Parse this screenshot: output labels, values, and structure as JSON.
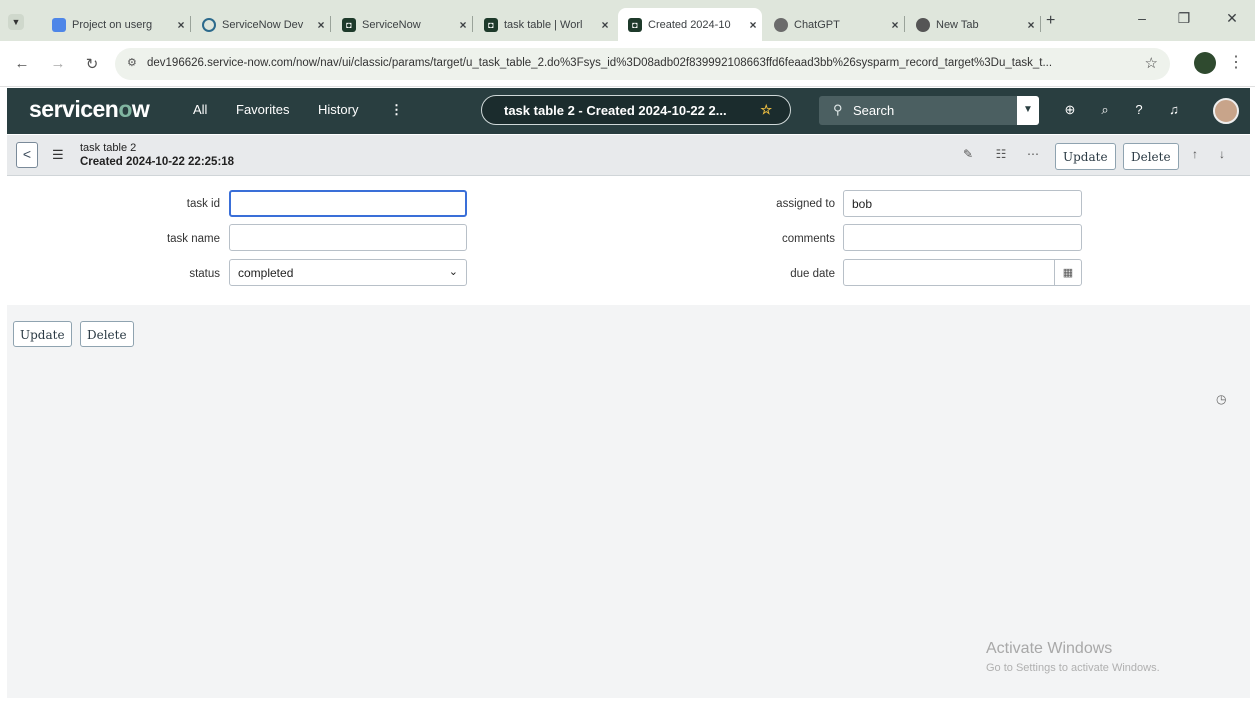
{
  "browser": {
    "tabs": [
      {
        "label": "Project on userg",
        "icon": "doc-icon"
      },
      {
        "label": "ServiceNow Dev",
        "icon": "ring-icon"
      },
      {
        "label": "ServiceNow",
        "icon": "servicenow-icon"
      },
      {
        "label": "task table | Worl",
        "icon": "servicenow-icon"
      },
      {
        "label": "Created 2024-10",
        "icon": "servicenow-icon",
        "active": true
      },
      {
        "label": "ChatGPT",
        "icon": "chatgpt-icon"
      },
      {
        "label": "New Tab",
        "icon": "chrome-icon"
      }
    ],
    "close_glyph": "×",
    "new_tab_glyph": "+",
    "url": "dev196626.service-now.com/now/nav/ui/classic/params/target/u_task_table_2.do%3Fsys_id%3D08adb02f839992108663ffd6feaad3bb%26sysparm_record_target%3Du_task_t..."
  },
  "sn_header": {
    "logo_pre": "servicen",
    "logo_o": "o",
    "logo_post": "w",
    "nav": [
      "All",
      "Favorites",
      "History"
    ],
    "more": "⋮",
    "context_pill": "task table 2 - Created 2024-10-22 2...",
    "search_placeholder": "Search"
  },
  "form_header": {
    "title": "task table 2",
    "subtitle": "Created 2024-10-22 22:25:18",
    "update_label": "Update",
    "delete_label": "Delete"
  },
  "form": {
    "left": [
      {
        "label": "task id",
        "value": ""
      },
      {
        "label": "task name",
        "value": ""
      },
      {
        "label": "status",
        "value": "completed"
      }
    ],
    "right": [
      {
        "label": "assigned to",
        "value": "bob"
      },
      {
        "label": "comments",
        "value": ""
      },
      {
        "label": "due date",
        "value": ""
      }
    ]
  },
  "bottom_buttons": {
    "update_label": "Update",
    "delete_label": "Delete"
  },
  "watermark": {
    "title": "Activate Windows",
    "subtitle": "Go to Settings to activate Windows."
  },
  "colors": {
    "sn_header_bg": "#293e40",
    "focus_border": "#3a6fd8"
  }
}
